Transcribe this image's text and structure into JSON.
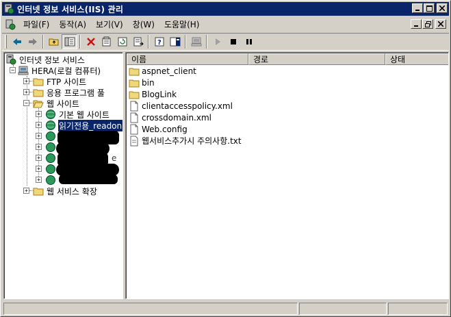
{
  "window": {
    "title": "인터넷 정보 서비스(IIS) 관리"
  },
  "menu": {
    "items": [
      "파일(F)",
      "동작(A)",
      "보기(V)",
      "창(W)",
      "도움말(H)"
    ]
  },
  "tree": {
    "root": "인터넷 정보 서비스",
    "computer": "HERA(로컬 컴퓨터)",
    "ftp_sites": "FTP 사이트",
    "app_pools": "응용 프로그램 풀",
    "web_sites": "웹 사이트",
    "default_site": "기본 웹 사이트",
    "selected_site": "읽기전용_readon",
    "partial_site": "e",
    "web_ext": "웹 서비스 확장"
  },
  "list": {
    "columns": [
      "이름",
      "경로",
      "상태"
    ],
    "rows": [
      {
        "name": "aspnet_client",
        "type": "folder"
      },
      {
        "name": "bin",
        "type": "folder"
      },
      {
        "name": "BlogLink",
        "type": "folder"
      },
      {
        "name": "clientaccesspolicy.xml",
        "type": "file"
      },
      {
        "name": "crossdomain.xml",
        "type": "file"
      },
      {
        "name": "Web.config",
        "type": "file"
      },
      {
        "name": "웹서비스추가시 주의사항.txt",
        "type": "file"
      }
    ]
  },
  "colors": {
    "titlebar": "#0a246a",
    "face": "#d4d0c8",
    "selection": "#0a246a"
  }
}
